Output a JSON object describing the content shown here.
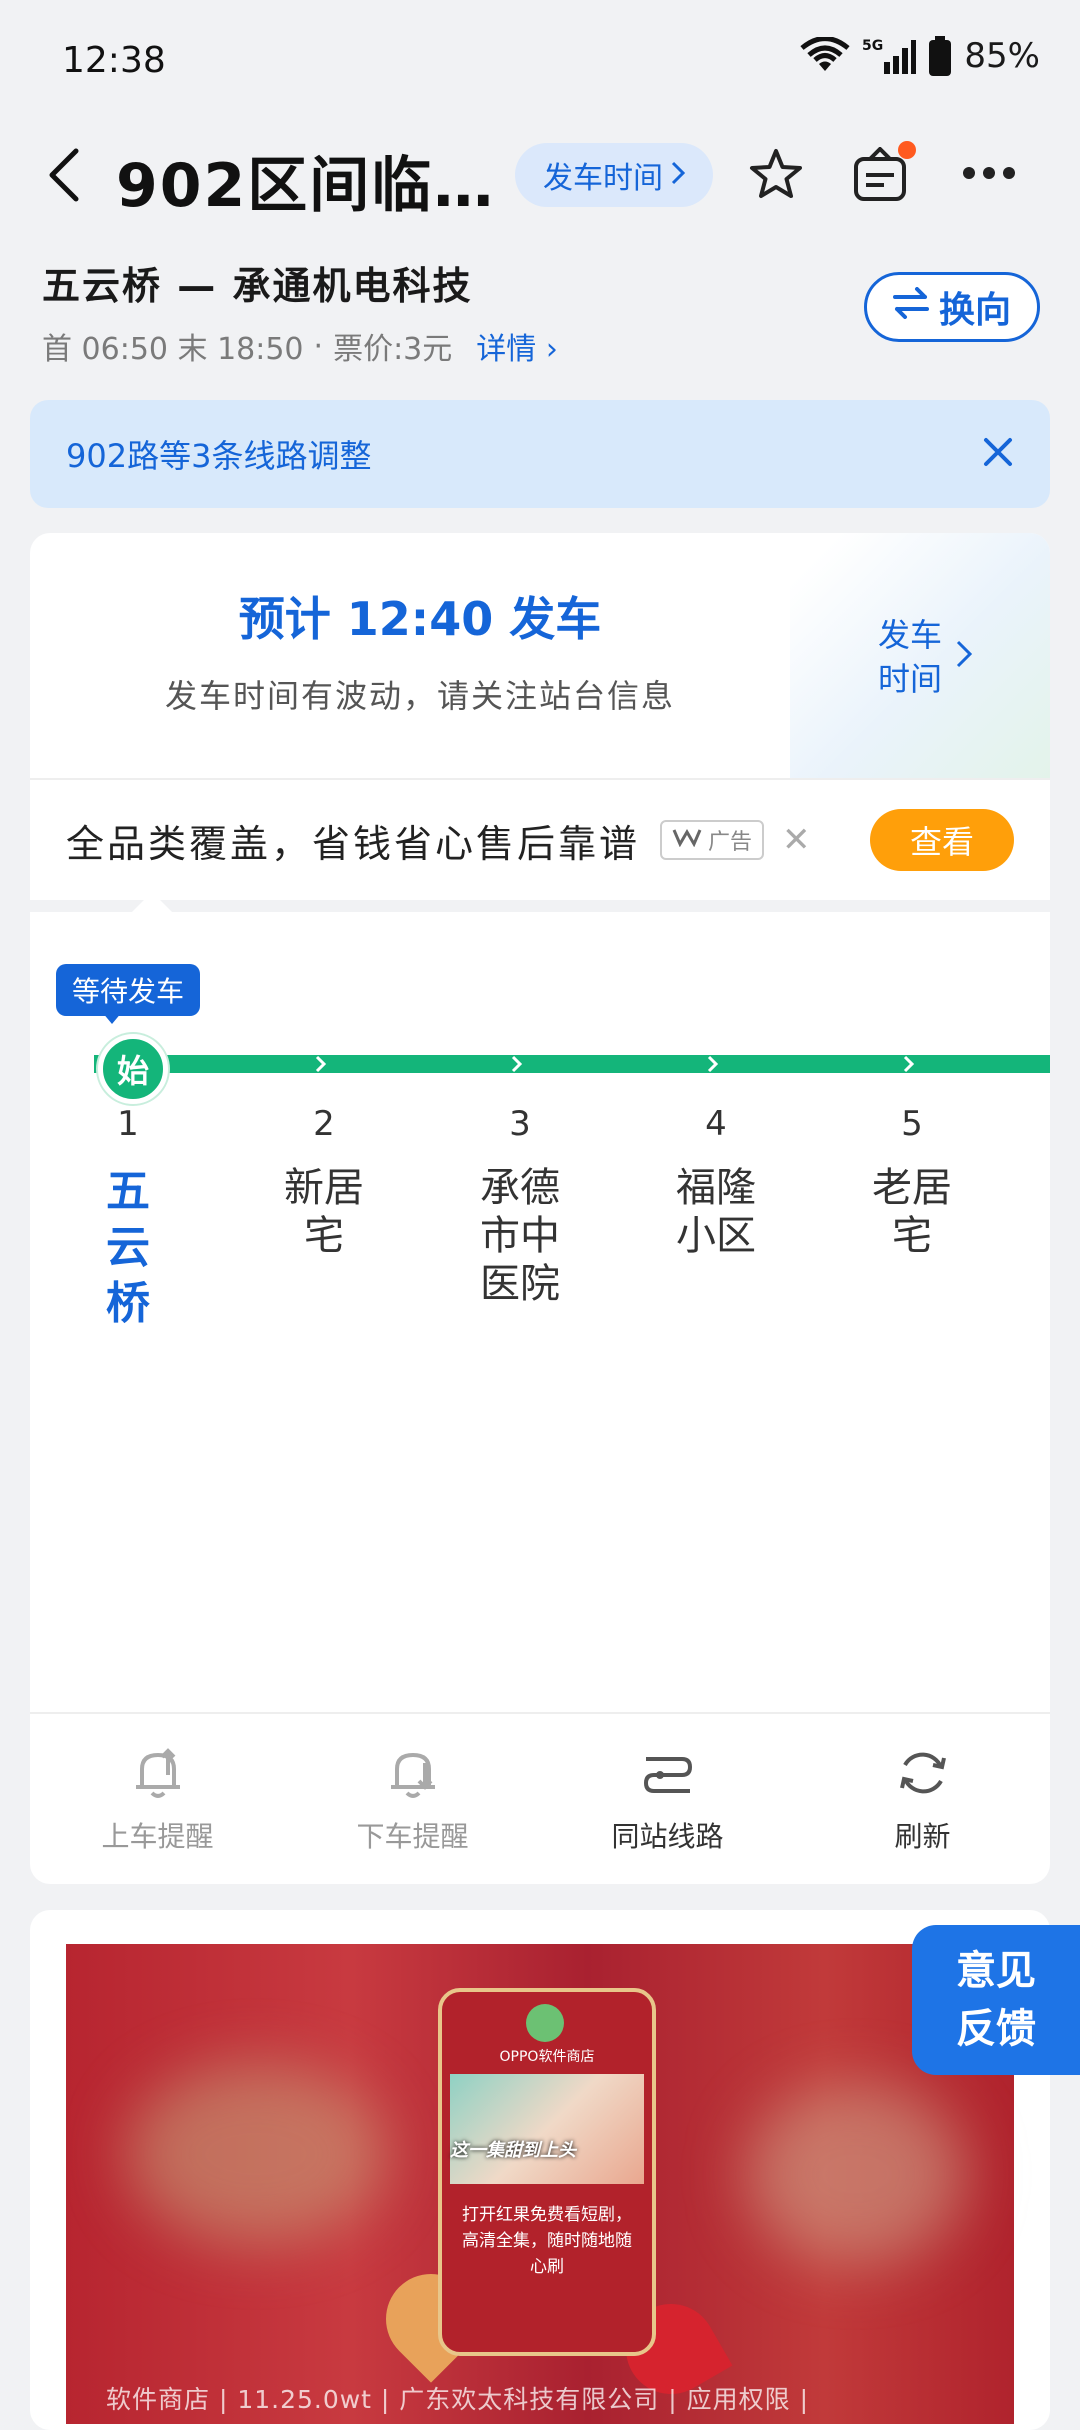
{
  "status_bar": {
    "time": "12:38",
    "network": "5G",
    "battery": "85%"
  },
  "header": {
    "title": "902区间临…",
    "departure_time_label": "发车时间"
  },
  "route": {
    "name": "五云桥 — 承通机电科技",
    "first_last": "首 06:50 末 18:50",
    "fare": "票价:3元",
    "details_label": "详情",
    "switch_label": "换向"
  },
  "notice": {
    "text": "902路等3条线路调整"
  },
  "departure": {
    "title": "预计 12:40 发车",
    "subtitle": "发车时间有波动，请关注站台信息",
    "schedule_link_line1": "发车",
    "schedule_link_line2": "时间"
  },
  "ad": {
    "text": "全品类覆盖，省钱省心售后靠谱",
    "badge": "广告",
    "button": "查看"
  },
  "line": {
    "waiting_label": "等待发车",
    "start_marker": "始",
    "accent_color": "#14b57a",
    "stops": [
      {
        "num": "1",
        "name": "五云桥"
      },
      {
        "num": "2",
        "name": "新居宅"
      },
      {
        "num": "3",
        "name": "承德市中医院"
      },
      {
        "num": "4",
        "name": "福隆小区"
      },
      {
        "num": "5",
        "name": "老居宅"
      }
    ]
  },
  "toolbar": {
    "board_alert": "上车提醒",
    "alight_alert": "下车提醒",
    "same_stop_lines": "同站线路",
    "refresh": "刷新"
  },
  "banner": {
    "store_name": "OPPO软件商店",
    "tagline": "这一集甜到上头",
    "copy": "打开红果免费看短剧，高清全集，随时随地随心刷",
    "footer": "软件商店 | 11.25.0wt | 广东欢太科技有限公司 | 应用权限 |"
  },
  "feedback": {
    "line1": "意见",
    "line2": "反馈"
  }
}
